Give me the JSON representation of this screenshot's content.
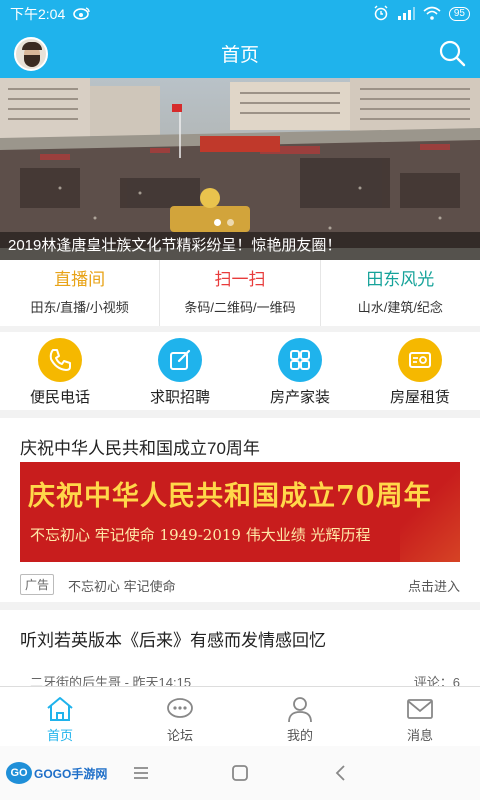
{
  "status_bar": {
    "time": "下午2:04",
    "battery": "95"
  },
  "header": {
    "title": "首页"
  },
  "banner": {
    "caption": "2019林逢唐皇壮族文化节精彩纷呈！惊艳朋友圈！"
  },
  "quick_links": [
    {
      "title": "直播间",
      "subtitle": "田东/直播/小视频",
      "color": "#e8a317"
    },
    {
      "title": "扫一扫",
      "subtitle": "条码/二维码/一维码",
      "color": "#e83b3b"
    },
    {
      "title": "田东风光",
      "subtitle": "山水/建筑/纪念",
      "color": "#17a39a"
    }
  ],
  "services": [
    {
      "label": "便民电话",
      "icon": "phone-icon",
      "color": "#f5b800"
    },
    {
      "label": "求职招聘",
      "icon": "edit-icon",
      "color": "#1fb3ec"
    },
    {
      "label": "房产家装",
      "icon": "grid-icon",
      "color": "#1fb3ec"
    },
    {
      "label": "房屋租赁",
      "icon": "id-card-icon",
      "color": "#f5b800"
    }
  ],
  "promo": {
    "title": "庆祝中华人民共和国成立70周年",
    "headline": "庆祝中华人民共和国成立70周年",
    "subline": "不忘初心  牢记使命  1949-2019 伟大业绩 光辉历程",
    "ad_tag": "广告",
    "ad_text": "不忘初心 牢记使命",
    "enter": "点击进入"
  },
  "article": {
    "title": "听刘若英版本《后来》有感而发情感回忆",
    "meta": "二牙街的后生哥 - 昨天14:15",
    "comments": "评论：6"
  },
  "tabs": [
    {
      "label": "首页",
      "icon": "home-icon",
      "active": true
    },
    {
      "label": "论坛",
      "icon": "chat-icon",
      "active": false
    },
    {
      "label": "我的",
      "icon": "user-icon",
      "active": false
    },
    {
      "label": "消息",
      "icon": "mail-icon",
      "active": false
    }
  ],
  "watermark": {
    "logo": "GO",
    "text": "GOGO手游网"
  },
  "colors": {
    "accent": "#1fb3ec"
  }
}
